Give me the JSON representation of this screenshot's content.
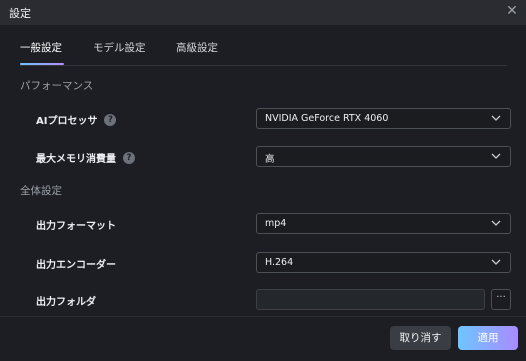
{
  "window": {
    "title": "設定"
  },
  "icons": {
    "close": "close-icon",
    "help": "help-circle-icon",
    "chevron": "chevron-down-icon",
    "more": "ellipsis-icon"
  },
  "colors": {
    "accent_start": "#6ec5ff",
    "accent_end": "#b48cff"
  },
  "tabs": [
    {
      "label": "一般設定",
      "active": true
    },
    {
      "label": "モデル設定",
      "active": false
    },
    {
      "label": "高級設定",
      "active": false
    }
  ],
  "sections": {
    "performance": {
      "title": "パフォーマンス",
      "ai_processor": {
        "label": "AIプロセッサ",
        "value": "NVIDIA GeForce RTX 4060"
      },
      "max_memory": {
        "label": "最大メモリ消費量",
        "value": "高"
      }
    },
    "global": {
      "title": "全体設定",
      "output_format": {
        "label": "出力フォーマット",
        "value": "mp4"
      },
      "output_encoder": {
        "label": "出力エンコーダー",
        "value": "H.264"
      },
      "output_folder": {
        "label": "出力フォルダ",
        "value": "",
        "browse_label": "···"
      }
    }
  },
  "footer": {
    "cancel_label": "取り消す",
    "apply_label": "適用"
  }
}
